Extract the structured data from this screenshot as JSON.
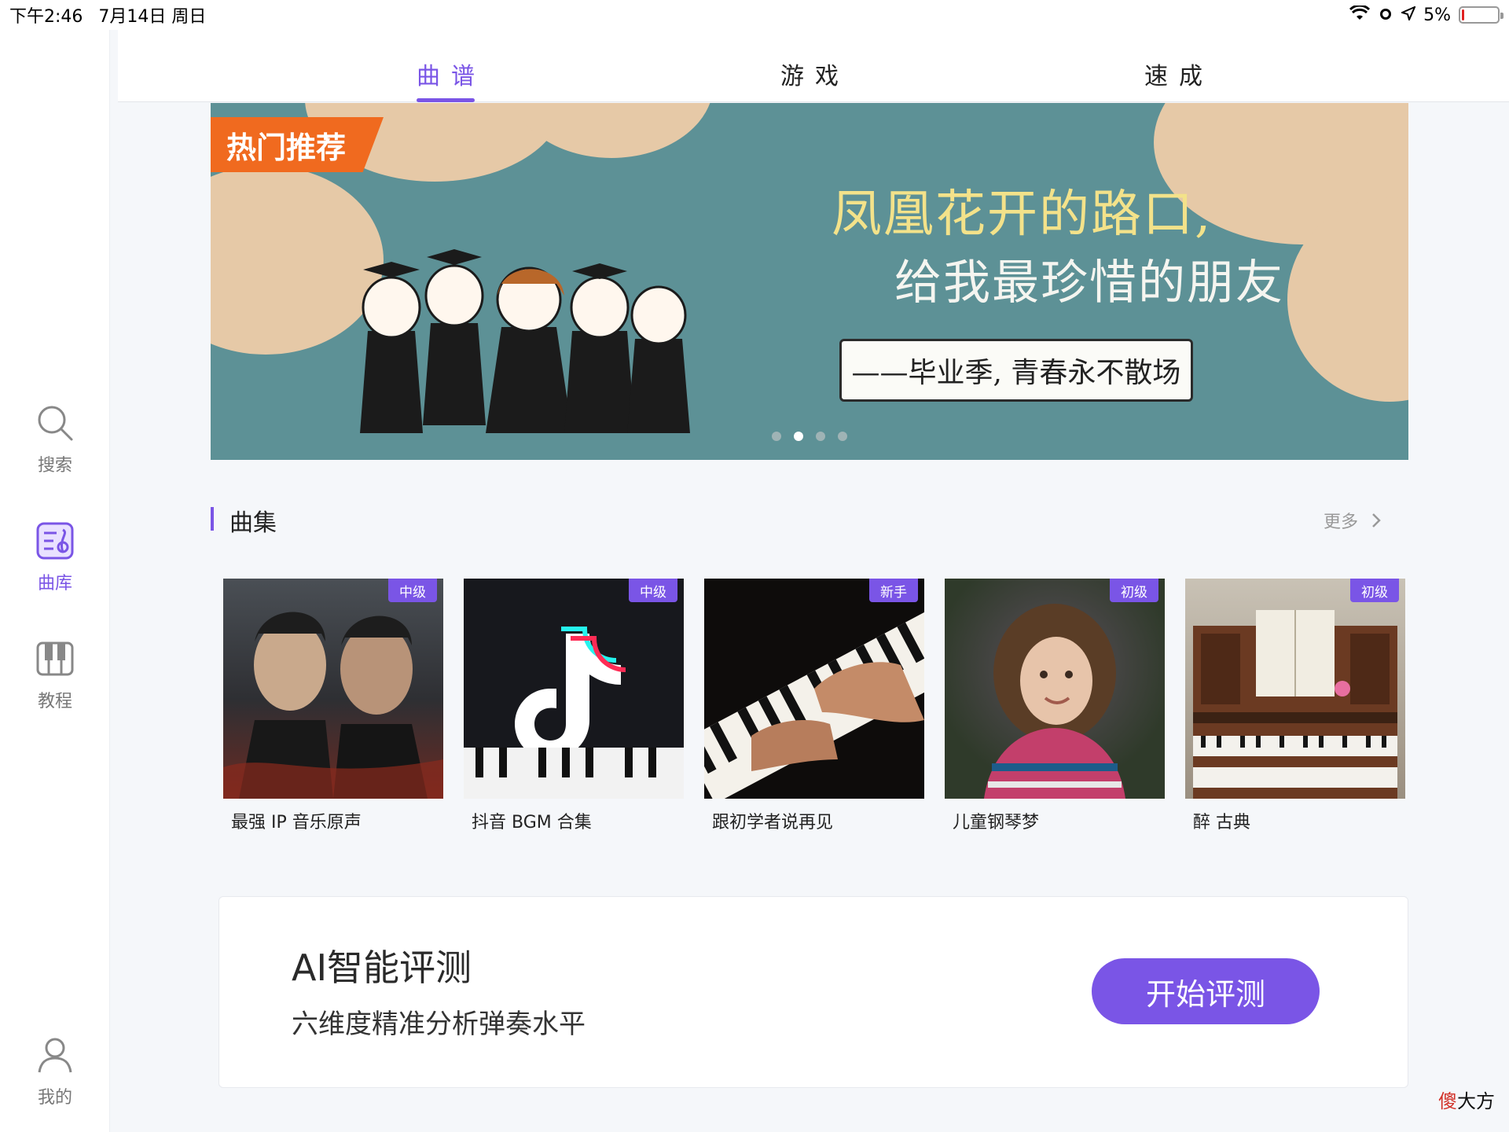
{
  "status_bar": {
    "time": "下午2:46",
    "date": "7月14日 周日",
    "battery_percent": "5%",
    "battery_level": 0.05
  },
  "sidebar": {
    "items": [
      {
        "label": "搜索",
        "icon": "search-icon"
      },
      {
        "label": "曲库",
        "icon": "music-library-icon"
      },
      {
        "label": "教程",
        "icon": "piano-icon"
      },
      {
        "label": "我的",
        "icon": "user-icon"
      }
    ],
    "active_index": 1
  },
  "tabs": [
    {
      "label": "曲谱"
    },
    {
      "label": "游戏"
    },
    {
      "label": "速成"
    }
  ],
  "banner": {
    "badge": "热门推荐",
    "title_line1": "凤凰花开的路口,",
    "title_line2": "给我最珍惜的朋友",
    "subtitle": "——毕业季, 青春永不散场",
    "active_dot": 1
  },
  "section": {
    "title": "曲集",
    "more_label": "更多",
    "more_icon": "chevron-right-icon"
  },
  "cards": [
    {
      "name": "最强 IP 音乐原声",
      "level": "中级"
    },
    {
      "name": "抖音 BGM 合集",
      "level": "中级"
    },
    {
      "name": "跟初学者说再见",
      "level": "新手"
    },
    {
      "name": "儿童钢琴梦",
      "level": "初级"
    },
    {
      "name": "醉 古典",
      "level": "初级"
    }
  ],
  "ai": {
    "title": "AI智能评测",
    "subtitle": "六维度精准分析弹奏水平",
    "button_label": "开始评测"
  },
  "watermark": {
    "red_part": "傻",
    "rest": "大方"
  },
  "colors": {
    "accent": "#7a55e6",
    "badge_orange": "#f06a1f",
    "banner_teal": "#5d9196"
  }
}
